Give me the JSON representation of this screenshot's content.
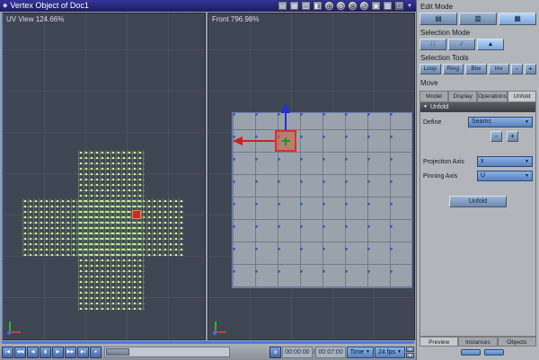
{
  "titlebar": {
    "title": "Vertex Object of Doc1"
  },
  "colors": {
    "accent_blue": "#5a82bc",
    "selection_red": "#e03020",
    "viewport_bg": "#3e4654",
    "mesh_dot": "#e6f0a8",
    "titlebar_bg": "#1c1c5e"
  },
  "icons": {
    "diamond": "◆",
    "chevron_down": "▼",
    "collapse_arrow": "▼",
    "close": "×",
    "layout": [
      "▤",
      "▦",
      "▥",
      "◧"
    ],
    "circles": [
      "⊕",
      "⊙",
      "⊗",
      "⊘"
    ],
    "misc": [
      "▣",
      "▩",
      "□"
    ],
    "playback": [
      "|◀",
      "◀◀",
      "◀",
      "▮",
      "▶",
      "▶▶",
      "▶|",
      "●"
    ],
    "spin_up": "▲",
    "spin_down": "▼",
    "edit_modes": [
      "▤",
      "▥",
      "▦"
    ],
    "selection_modes": [
      "∷",
      "∕",
      "▲"
    ]
  },
  "viewports": {
    "uv_label": "UV View 124.66%",
    "front_label": "Front 796.98%"
  },
  "panel": {
    "edit_mode_label": "Edit Mode",
    "selection_mode_label": "Selection Mode",
    "selection_tools_label": "Selection Tools",
    "selection_tools": [
      "Loop",
      "Ring",
      "Btw",
      "Inv"
    ],
    "minus": "-",
    "plus": "+",
    "tool_name": "Move",
    "tabs": [
      "Model",
      "Display",
      "Operations",
      "Unfold"
    ],
    "unfold": {
      "header": "Unfold",
      "define_label": "Define",
      "define_value": "Seams",
      "minus": "-",
      "plus": "+",
      "projection_axis_label": "Projection Axis",
      "projection_axis_value": "x",
      "pinning_axis_label": "Pinning Axis",
      "pinning_axis_value": "U",
      "unfold_button": "Unfold"
    },
    "bottom_tabs": [
      "Preview",
      "Instances",
      "Objects"
    ]
  },
  "timeline": {
    "current_time": "00:00:00",
    "separator": "/",
    "end_time": "00:07:00",
    "mode": "Time",
    "fps": "24 fps"
  }
}
